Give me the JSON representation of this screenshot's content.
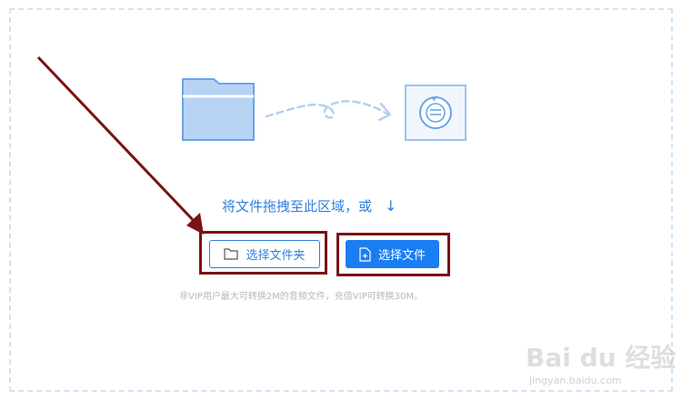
{
  "upload": {
    "prompt": "将文件拖拽至此区域，或",
    "down_arrow": "↓",
    "folder_button": "选择文件夹",
    "file_button": "选择文件",
    "hint": "非VIP用户最大可转换2M的音频文件，充值VIP可转换30M。"
  },
  "watermark": {
    "brand": "Bai du 经验",
    "url": "jingyan.baidu.com"
  },
  "colors": {
    "accent": "#1a7ef2",
    "link_blue": "#2f7fdc",
    "dashed_border": "#cfe3f7",
    "annotation_red": "#7a1216",
    "hint_gray": "#b8b8b8"
  },
  "icons": {
    "folder": "folder-icon",
    "file_add": "file-add-icon",
    "audio_convert": "audio-convert-icon",
    "down_arrow": "down-arrow-icon"
  }
}
